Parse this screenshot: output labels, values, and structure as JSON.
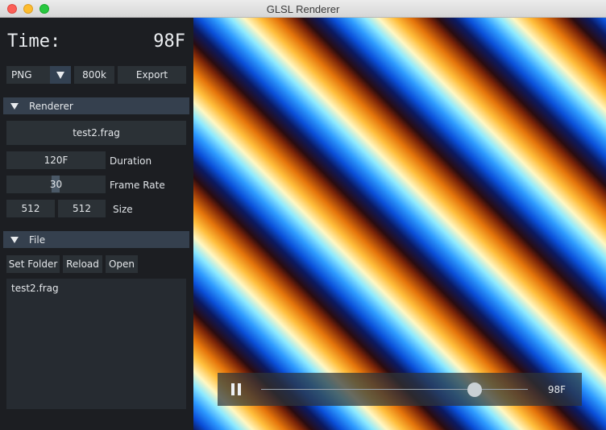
{
  "window": {
    "title": "GLSL Renderer"
  },
  "header": {
    "time_label": "Time:",
    "time_value": "98F"
  },
  "export": {
    "format": "PNG",
    "bitrate": "800k",
    "export_label": "Export"
  },
  "renderer_section": {
    "title": "Renderer",
    "shader_file": "test2.frag",
    "duration_value": "120F",
    "duration_label": "Duration",
    "frame_rate_value": "30",
    "frame_rate_label": "Frame Rate",
    "width_value": "512",
    "height_value": "512",
    "size_label": "Size"
  },
  "file_section": {
    "title": "File",
    "set_folder_label": "Set Folder",
    "reload_label": "Reload",
    "open_label": "Open",
    "files": [
      "test2.frag"
    ]
  },
  "playback": {
    "frame_label": "98F",
    "progress": 0.8
  },
  "colors": {
    "panel_bg": "#1c1e22",
    "control_bg": "#2b3136",
    "section_header_bg": "#35404e"
  }
}
